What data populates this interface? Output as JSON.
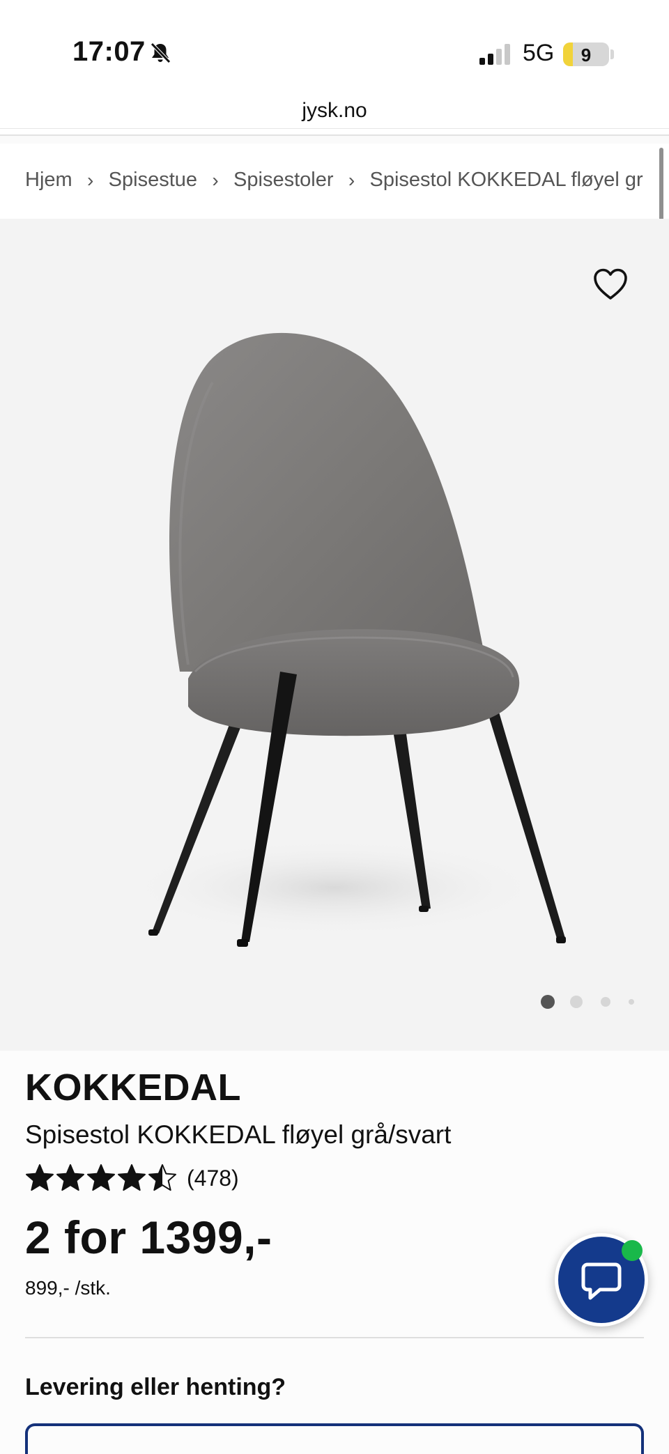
{
  "status_bar": {
    "time": "17:07",
    "network": "5G",
    "battery": "9",
    "battery_fraction": 0.09
  },
  "browser": {
    "url": "jysk.no"
  },
  "breadcrumb": [
    "Hjem",
    "Spisestue",
    "Spisestoler",
    "Spisestol KOKKEDAL fløyel gr"
  ],
  "gallery": {
    "image_count": 4,
    "active_index": 0
  },
  "product": {
    "brand": "KOKKEDAL",
    "name": "Spisestol KOKKEDAL fløyel grå/svart",
    "rating": 4.5,
    "rating_count": "(478)",
    "price": "2 for 1399,-",
    "unit_price": "899,- /stk."
  },
  "delivery": {
    "heading": "Levering eller henting?"
  },
  "colors": {
    "brand_blue": "#143a8c",
    "online_green": "#19b84a"
  },
  "icons": {
    "favorite": "heart-icon",
    "chat": "chat-bubble-icon",
    "silent": "bell-slash-icon",
    "signal": "signal-icon"
  }
}
